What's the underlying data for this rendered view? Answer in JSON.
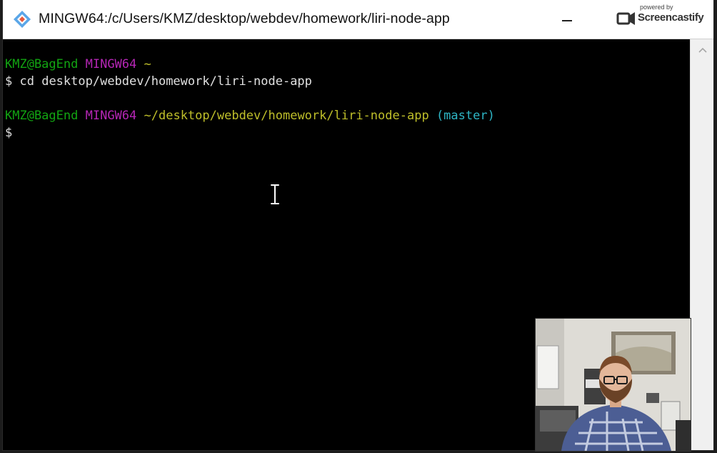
{
  "window": {
    "title": "MINGW64:/c/Users/KMZ/desktop/webdev/homework/liri-node-app",
    "minimize_label": "—"
  },
  "watermark": {
    "powered_by": "powered by",
    "name": "Screencastify"
  },
  "terminal": {
    "lines": [
      {
        "user_host": "KMZ@BagEnd",
        "shell": "MINGW64",
        "path": "~"
      },
      {
        "prompt": "$",
        "command": "cd desktop/webdev/homework/liri-node-app"
      },
      {
        "user_host": "KMZ@BagEnd",
        "shell": "MINGW64",
        "path": "~/desktop/webdev/homework/liri-node-app",
        "branch": "(master)"
      },
      {
        "prompt": "$"
      }
    ]
  },
  "colors": {
    "user_host": "#12a512",
    "shell": "#b526b5",
    "path": "#bfbf2a",
    "branch": "#2eb6c6",
    "background": "#000000"
  },
  "icons": {
    "app": "git-bash-icon",
    "scroll_up": "chevron-up-icon",
    "cursor": "text-cursor-icon",
    "watermark": "screencastify-logo-icon"
  }
}
